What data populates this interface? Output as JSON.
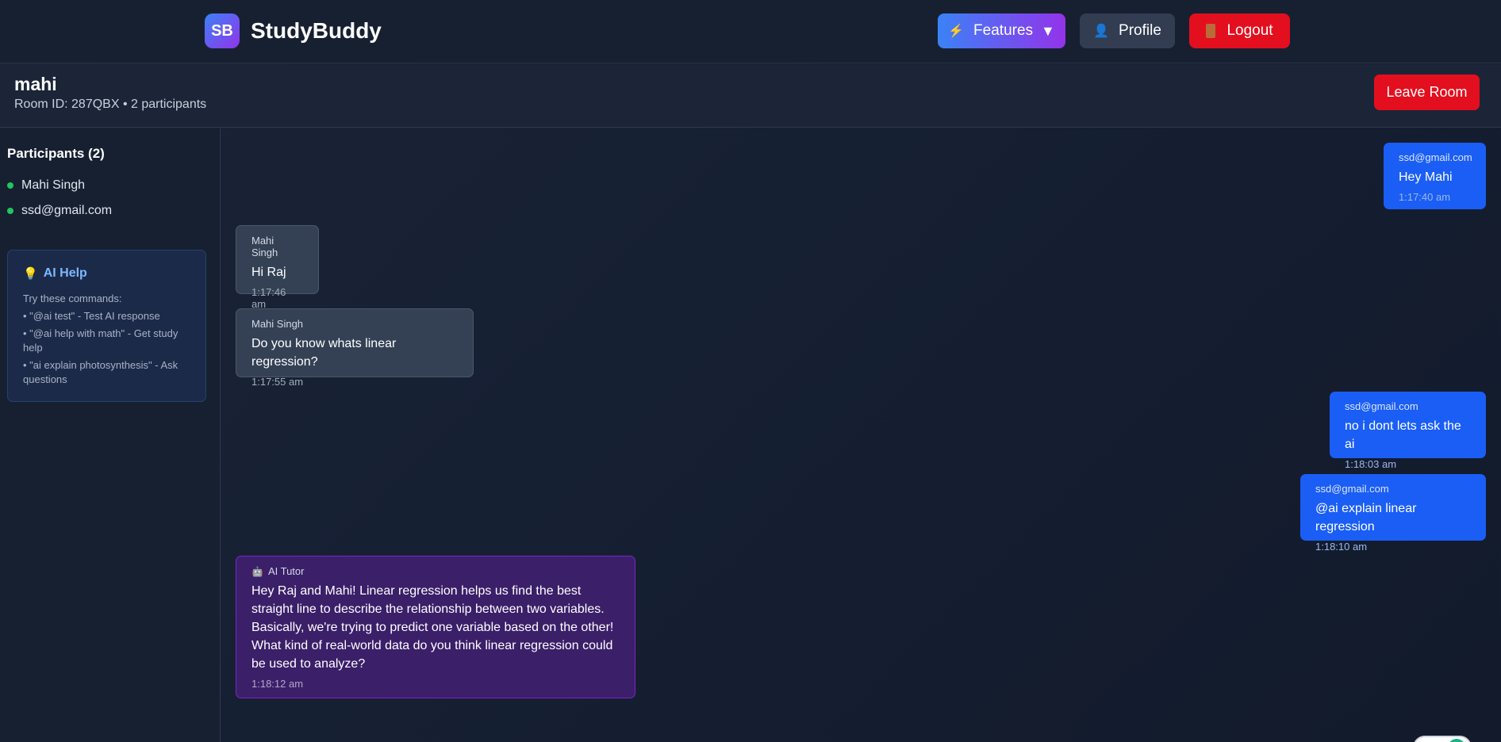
{
  "app": {
    "logo_text": "SB",
    "name": "StudyBuddy"
  },
  "nav": {
    "features_label": "Features",
    "features_caret": "▼",
    "profile_label": "Profile",
    "logout_label": "Logout"
  },
  "room": {
    "name": "mahi",
    "meta": "Room ID: 287QBX • 2 participants",
    "leave_label": "Leave Room"
  },
  "sidebar": {
    "participants_title": "Participants (2)",
    "participants": [
      "Mahi Singh",
      "ssd@gmail.com"
    ],
    "ai_help": {
      "title": "AI Help",
      "intro": "Try these commands:",
      "commands": [
        "• \"@ai test\" - Test AI response",
        "• \"@ai help with math\" - Get study help",
        "• \"ai explain photosynthesis\" - Ask questions"
      ]
    }
  },
  "messages": [
    {
      "sender": "ssd@gmail.com",
      "text": "Hey Mahi",
      "time": "1:17:40 am",
      "kind": "outgoing"
    },
    {
      "sender": "Mahi Singh",
      "text": "Hi Raj",
      "time": "1:17:46 am",
      "kind": "incoming"
    },
    {
      "sender": "Mahi Singh",
      "text": "Do you know whats linear regression?",
      "time": "1:17:55 am",
      "kind": "incoming"
    },
    {
      "sender": "ssd@gmail.com",
      "text": "no i dont lets ask the ai",
      "time": "1:18:03 am",
      "kind": "outgoing"
    },
    {
      "sender": "ssd@gmail.com",
      "text": "@ai explain linear regression",
      "time": "1:18:10 am",
      "kind": "outgoing"
    },
    {
      "sender": "AI Tutor",
      "text": "Hey Raj and Mahi! Linear regression helps us find the best straight line to describe the relationship between two variables. Basically, we're trying to predict one variable based on the other! What kind of real-world data do you think linear regression could be used to analyze?",
      "time": "1:18:12 am",
      "kind": "ai"
    }
  ],
  "icons": {
    "features": "lightning-bolt",
    "profile": "person",
    "logout": "door",
    "ai_help": "lightbulb",
    "ai_tutor": "robot"
  },
  "colors": {
    "accent_blue": "#1a5ef5",
    "danger_red": "#e30f1e",
    "online_green": "#22c55e",
    "ai_purple": "#7e22ce"
  }
}
